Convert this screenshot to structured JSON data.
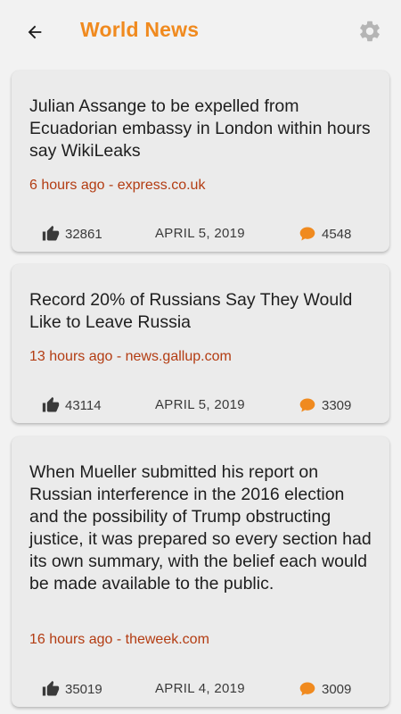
{
  "app": {
    "title": "World News",
    "accent_color": "#f08a1f",
    "source_color": "#b33c12",
    "back_icon": "arrow-left-icon",
    "settings_icon": "gear-icon"
  },
  "articles": [
    {
      "headline": "Julian Assange to be expelled from Ecuadorian embassy in London within hours say WikiLeaks",
      "meta": "6 hours ago - express.co.uk",
      "likes": "32861",
      "date": "APRIL 5, 2019",
      "comments": "4548"
    },
    {
      "headline": "Record 20% of Russians Say They Would Like to Leave Russia",
      "meta": "13 hours ago - news.gallup.com",
      "likes": "43114",
      "date": "APRIL 5, 2019",
      "comments": "3309"
    },
    {
      "headline": "When Mueller submitted his report on Russian interference in the 2016 election and the possibility of Trump obstructing justice, it was prepared so every section had its own summary, with the belief each would be made available to the public.",
      "meta": "16 hours ago - theweek.com",
      "likes": "35019",
      "date": "APRIL 4, 2019",
      "comments": "3009"
    }
  ]
}
